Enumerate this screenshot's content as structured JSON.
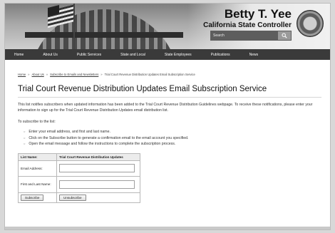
{
  "header": {
    "official_name": "Betty T. Yee",
    "office_title": "California State Controller",
    "search_placeholder": "Search"
  },
  "nav": {
    "items": [
      "Home",
      "About Us",
      "Public Services",
      "State and Local",
      "State Employees",
      "Publications",
      "News"
    ]
  },
  "breadcrumb": {
    "items": [
      "Home",
      "About Us",
      "Subscribe to Emails and Newsletters"
    ],
    "current": "Trial Court Revenue Distribution Updates Email Subscription Service"
  },
  "page": {
    "title": "Trial Court Revenue Distribution Updates Email Subscription Service",
    "intro": "This list notifies subscribers when updated information has been added to the Trial Court Revenue Distribution Guidelines webpage. To receive these notifications, please enter your information to sign up for the Trial Court Revenue Distribution Updates email distribution list.",
    "subscribe_intro": "To subscribe to the list:",
    "steps": [
      "Enter your email address, and first and last name.",
      "Click on the Subscribe button to generate a confirmation email to the email account you specified.",
      "Open the email message and follow the instructions to complete the subscription process."
    ]
  },
  "form": {
    "list_name_label": "List Name:",
    "list_name_value": "Trial Court Revenue Distribution Updates",
    "email_label": "Email Address:",
    "name_label": "First and Last Name:",
    "email_value": "",
    "name_value": "",
    "subscribe_label": "Subscribe",
    "unsubscribe_label": "Unsubscribe"
  },
  "colors": {
    "nav_bg": "#3a3a3a",
    "search_bg": "#5d5d5d"
  }
}
